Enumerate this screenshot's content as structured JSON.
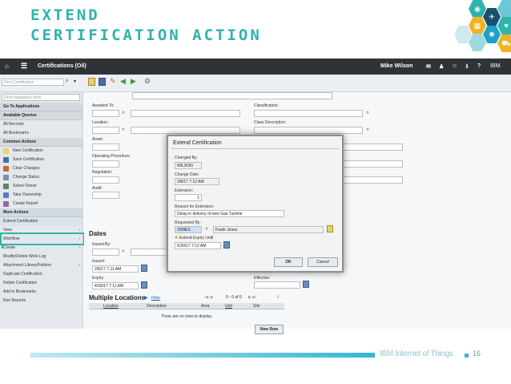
{
  "slide": {
    "title_line1": "EXTEND",
    "title_line2": "CERTIFICATION ACTION",
    "footer": "IBM Internet of Things",
    "page_number": "16"
  },
  "app": {
    "title": "Certifications (Oil)",
    "user": "Mike Wilson",
    "brand": "IBM."
  },
  "toolbar": {
    "find_placeholder": "Find Certification"
  },
  "sidebar": {
    "nav_placeholder": "Find Navigation Item",
    "go_to": "Go To Applications",
    "queries_header": "Available Queries",
    "queries": [
      "All Records",
      "All Bookmarks"
    ],
    "common_header": "Common Actions",
    "common": [
      "New Certification",
      "Save Certification",
      "Clear Changes",
      "Change Status",
      "Select Owner",
      "Take Ownership",
      "Create Report"
    ],
    "more_header": "More Actions",
    "more": [
      "Extend Certification",
      "View",
      "Workflow",
      "Create",
      "Modify/Delete Work Log",
      "Attachment Library/Folders",
      "Duplicate Certification",
      "Delete Certification",
      "Add to Bookmarks",
      "Run Reports"
    ]
  },
  "form": {
    "awarded_to": "Awarded To:",
    "classification": "Classification:",
    "location": "Location:",
    "class_description": "Class Description:",
    "asset": "Asset:",
    "operating_procedure": "Operating Procedure:",
    "regulation": "Regulation:",
    "audit": "Audit:",
    "dates_header": "Dates",
    "issued_by": "Issued By:",
    "issued": "Issued:",
    "issued_value": "2/8/17 7:11 AM",
    "expiry": "Expiry:",
    "expiry_value": "4/30/17 7:11 AM",
    "effective": "Effective:"
  },
  "locations": {
    "header": "Multiple Locations",
    "filter": "Filter",
    "pager": "0 - 0 of 0",
    "columns": [
      "Location",
      "Description",
      "Area",
      "Unit",
      "Site"
    ],
    "empty": "There are no rows to display.",
    "new_row": "New Row"
  },
  "dialog": {
    "title": "Extend Certification",
    "changed_by_label": "Changed By:",
    "changed_by": "WILSON",
    "change_date_label": "Change Date:",
    "change_date": "2/8/17 7:12 AM",
    "extension_label": "Extension:",
    "extension": "1",
    "reason_label": "Reason for Extension:",
    "reason": "Delay in delivery of new Gas Turbine",
    "requested_by_label": "Requested By:",
    "requested_by": "JONES",
    "requested_by_name": "Frank Jones",
    "expiry_label": "Extend Expiry Until",
    "expiry": "6/30/17 7:12 AM",
    "ok": "OK",
    "cancel": "Cancel"
  },
  "colors": {
    "accent": "#2fb3ae",
    "topbar": "#2f3338"
  }
}
